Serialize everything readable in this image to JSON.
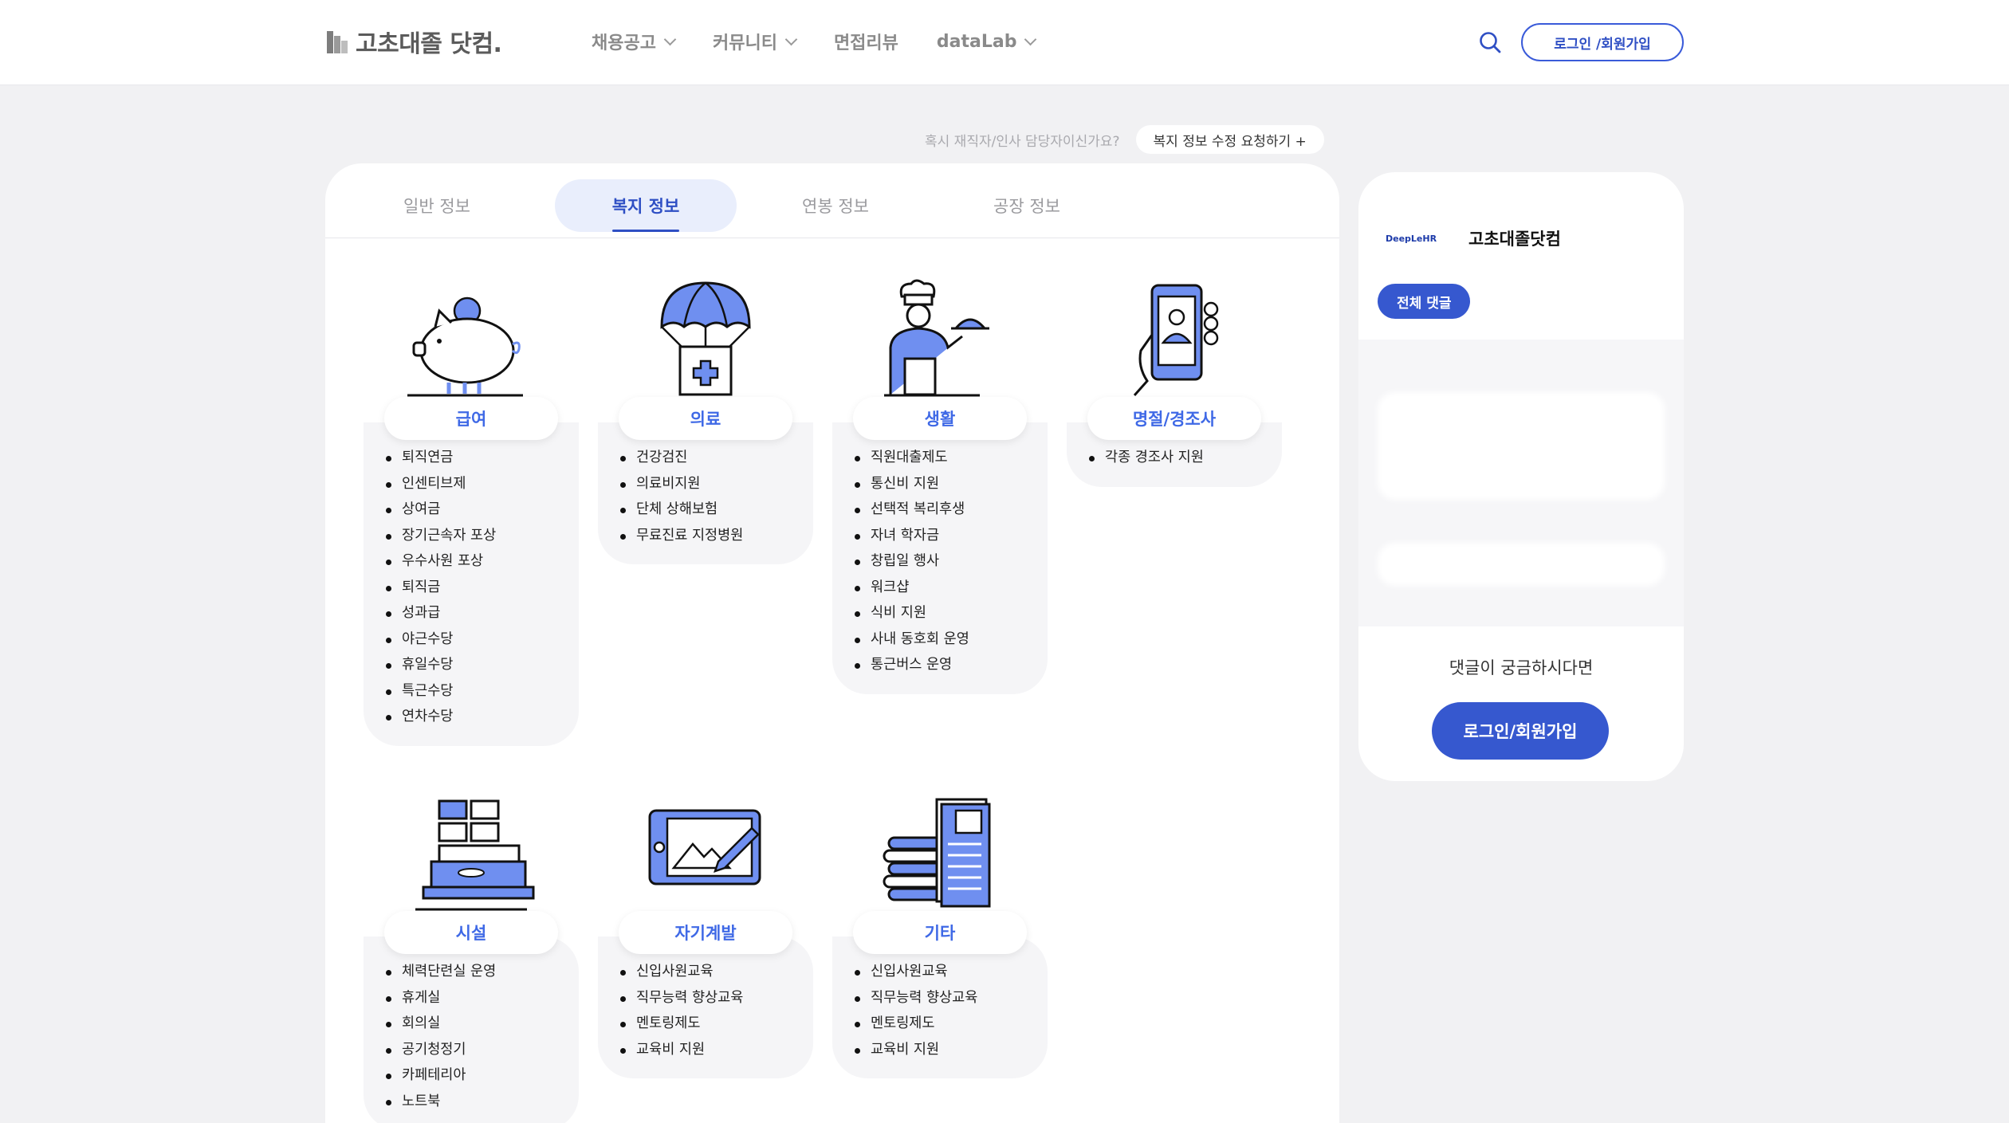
{
  "header": {
    "logo_text": "고초대졸 닷컴.",
    "nav": [
      "채용공고",
      "커뮤니티",
      "면접리뷰",
      "dataLab"
    ],
    "login_label": "로그인 /회원가입"
  },
  "request": {
    "question": "혹시 재직자/인사 담당자이신가요?",
    "button_label": "복지 정보 수정 요청하기 +"
  },
  "tabs": [
    "일반 정보",
    "복지 정보",
    "연봉 정보",
    "공장 정보"
  ],
  "active_tab": "복지 정보",
  "categories": [
    {
      "title": "급여",
      "icon": "piggy-bank-icon",
      "items": [
        "퇴직연금",
        "인센티브제",
        "상여금",
        "장기근속자 포상",
        "우수사원 포상",
        "퇴직금",
        "성과급",
        "야근수당",
        "휴일수당",
        "특근수당",
        "연차수당"
      ]
    },
    {
      "title": "의료",
      "icon": "medical-parachute-icon",
      "items": [
        "건강검진",
        "의료비지원",
        "단체 상해보험",
        "무료진료 지정병원"
      ]
    },
    {
      "title": "생활",
      "icon": "chef-icon",
      "items": [
        "직원대출제도",
        "통신비 지원",
        "선택적 복리후생",
        "자녀 학자금",
        "창립일 행사",
        "워크샵",
        "식비 지원",
        "사내 동호회 운영",
        "통근버스 운영"
      ]
    },
    {
      "title": "명절/경조사",
      "icon": "phone-gift-icon",
      "items": [
        "각종 경조사 지원"
      ]
    },
    {
      "title": "시설",
      "icon": "office-facility-icon",
      "items": [
        "체력단련실 운영",
        "휴게실",
        "회의실",
        "공기청정기",
        "카페테리아",
        "노트북"
      ]
    },
    {
      "title": "자기계발",
      "icon": "tablet-pen-icon",
      "items": [
        "신입사원교육",
        "직무능력 향상교육",
        "멘토링제도",
        "교육비 지원"
      ]
    },
    {
      "title": "기타",
      "icon": "books-icon",
      "items": [
        "신입사원교육",
        "직무능력 향상교육",
        "멘토링제도",
        "교육비 지원"
      ]
    }
  ],
  "side": {
    "company_logo_text": "DeepLeHR",
    "company_name": "고초대졸닷컴",
    "all_comments_label": "전체 댓글",
    "cta_text": "댓글이 궁금하시다면",
    "login_label": "로그인/회원가입"
  },
  "colors": {
    "accent": "#3658cf",
    "category_title": "#3f69e6",
    "active_tab_bg": "#e9eefc"
  }
}
